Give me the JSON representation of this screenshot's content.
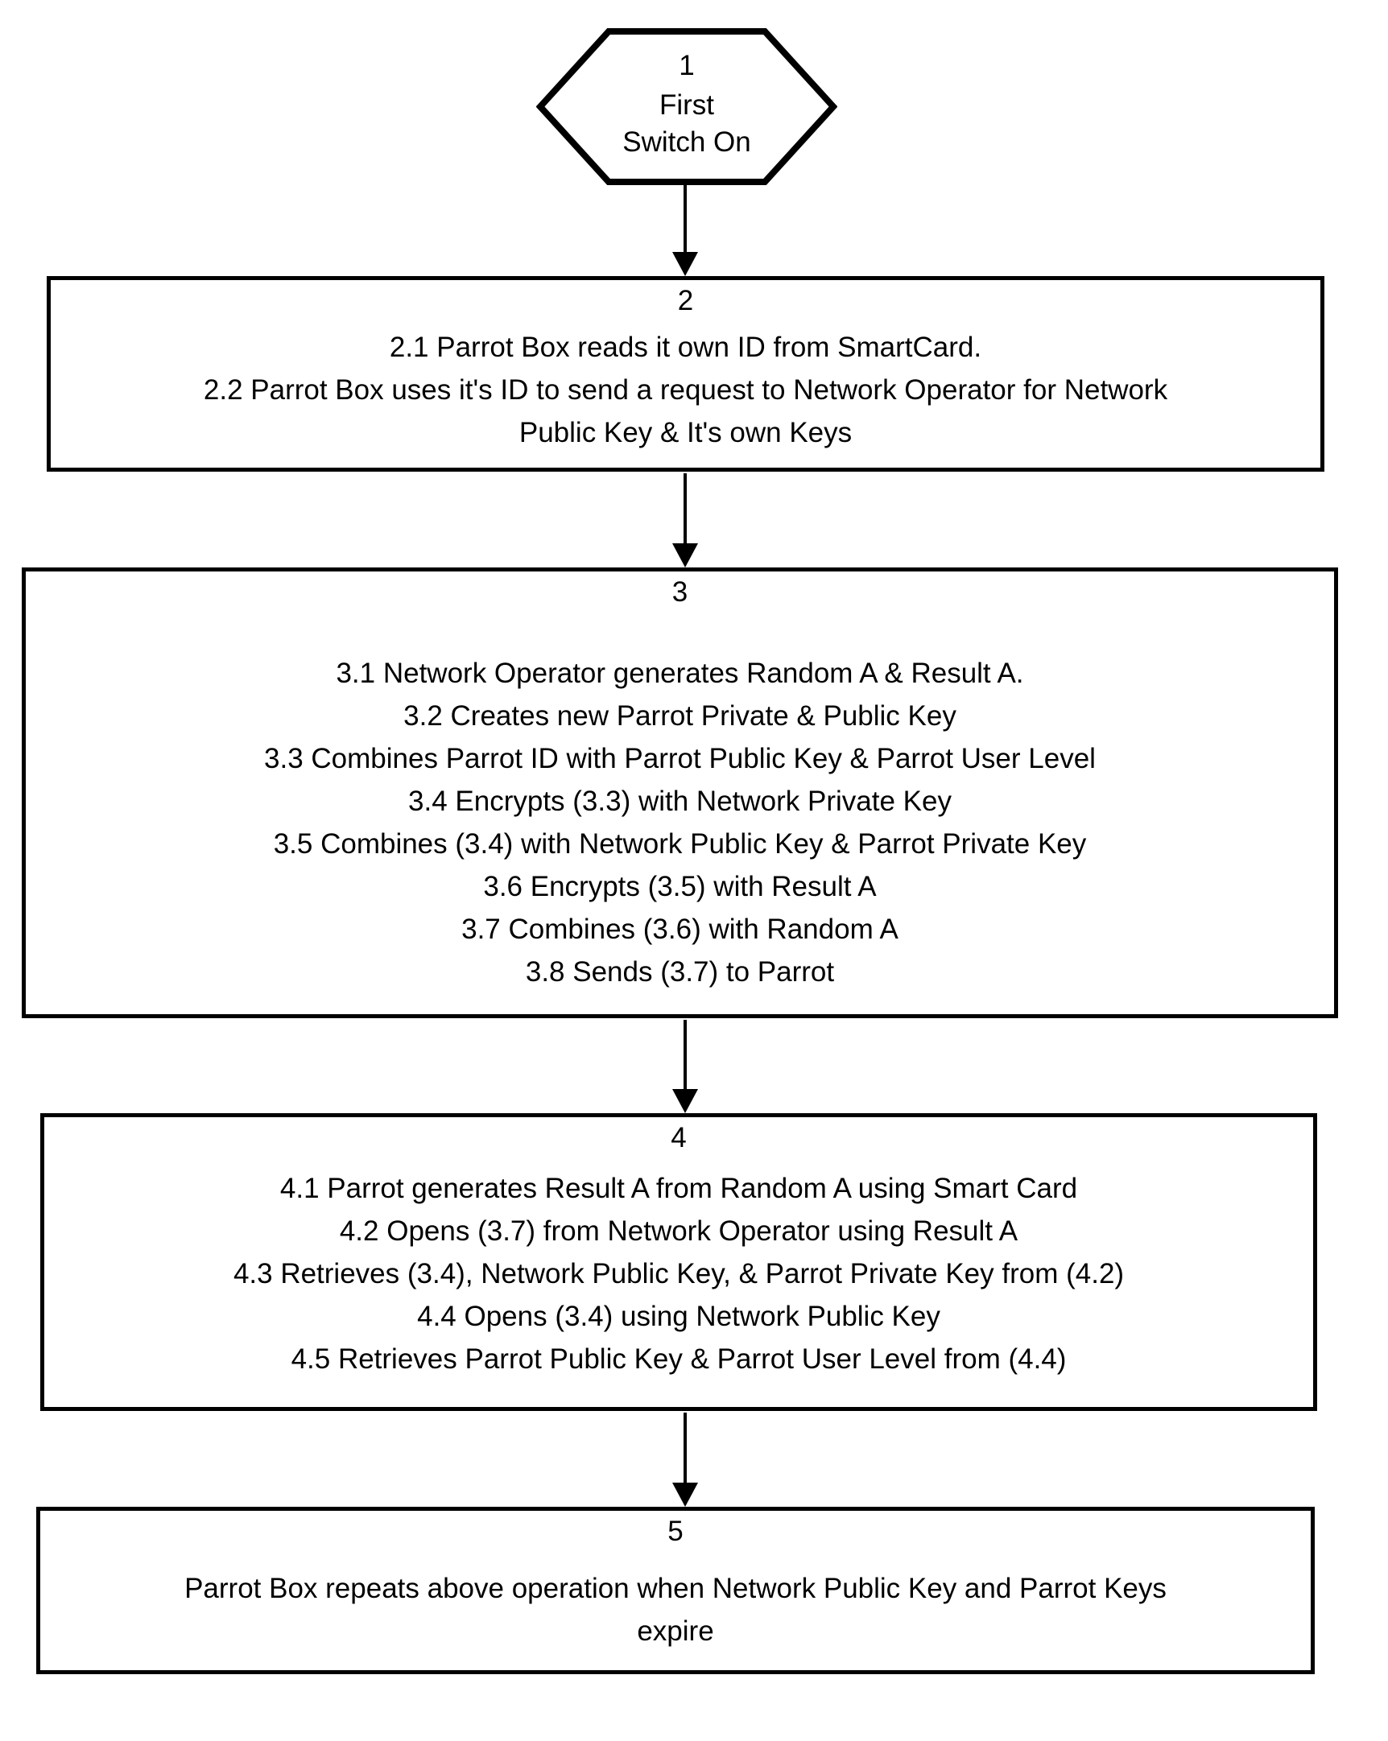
{
  "diagram": {
    "title": "First Switch On key provisioning flowchart",
    "colors": {
      "ink": "#000000",
      "paper": "#ffffff"
    },
    "nodes": [
      {
        "id": "node-1",
        "shape": "hexagon",
        "number": "1",
        "lines": [
          "First",
          "Switch On"
        ]
      },
      {
        "id": "node-2",
        "shape": "process",
        "number": "2",
        "lines": [
          "2.1 Parrot Box reads it own ID from SmartCard.",
          "2.2 Parrot Box uses it's ID to send a request to Network Operator for Network",
          "Public Key & It's own Keys"
        ]
      },
      {
        "id": "node-3",
        "shape": "process",
        "number": "3",
        "lines": [
          "3.1 Network Operator generates Random A & Result A.",
          "3.2 Creates new Parrot Private & Public Key",
          "3.3 Combines Parrot ID with Parrot Public Key & Parrot User Level",
          "3.4 Encrypts (3.3) with Network Private Key",
          "3.5 Combines (3.4) with Network Public Key & Parrot Private Key",
          "3.6 Encrypts (3.5) with Result A",
          "3.7 Combines (3.6) with Random A",
          "3.8 Sends (3.7) to Parrot"
        ]
      },
      {
        "id": "node-4",
        "shape": "process",
        "number": "4",
        "lines": [
          "4.1 Parrot generates Result A from Random A using Smart Card",
          "4.2 Opens (3.7) from Network Operator using Result A",
          "4.3 Retrieves (3.4), Network Public Key, & Parrot Private Key from (4.2)",
          "4.4 Opens (3.4) using Network Public Key",
          "4.5 Retrieves Parrot Public Key & Parrot User Level from (4.4)"
        ]
      },
      {
        "id": "node-5",
        "shape": "process",
        "number": "5",
        "lines": [
          "Parrot Box repeats above operation when Network Public Key and Parrot Keys",
          "expire"
        ]
      }
    ],
    "connectors": [
      {
        "id": "connector-1-2",
        "from": "node-1",
        "to": "node-2",
        "direction": "down"
      },
      {
        "id": "connector-2-3",
        "from": "node-2",
        "to": "node-3",
        "direction": "down"
      },
      {
        "id": "connector-3-4",
        "from": "node-3",
        "to": "node-4",
        "direction": "down"
      },
      {
        "id": "connector-4-5",
        "from": "node-4",
        "to": "node-5",
        "direction": "down"
      }
    ]
  }
}
